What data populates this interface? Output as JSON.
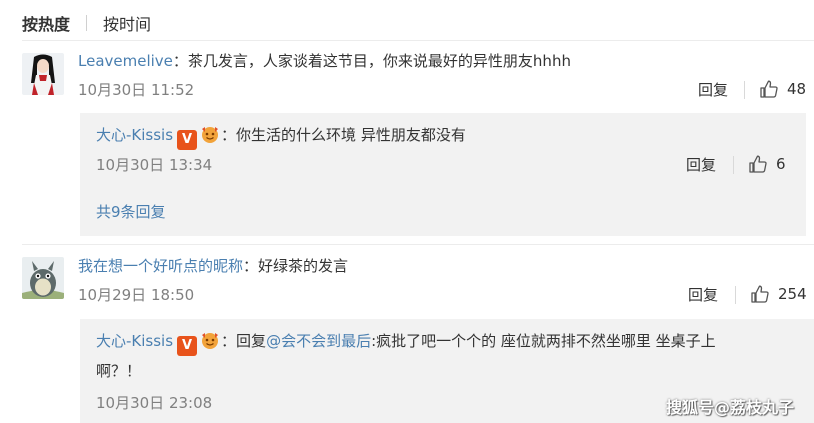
{
  "sort": {
    "hot_label": "按热度",
    "time_label": "按时间"
  },
  "comments": [
    {
      "username": "Leavemelive",
      "colon": "：",
      "text": "茶几发言，人家谈着这节目，你来说最好的异性朋友hhhh",
      "time": "10月30日 11:52",
      "reply_label": "回复",
      "likes": "48",
      "replies": [
        {
          "username": "大心-Kissis",
          "colon": "：",
          "text": "你生活的什么环境 异性朋友都没有",
          "time": "10月30日 13:34",
          "reply_label": "回复",
          "likes": "6"
        }
      ],
      "more_replies": "共9条回复"
    },
    {
      "username": "我在想一个好听点的昵称",
      "colon": "：",
      "text": "好绿茶的发言",
      "time": "10月29日 18:50",
      "reply_label": "回复",
      "likes": "254",
      "replies": [
        {
          "username": "大心-Kissis",
          "colon": "：",
          "reply_prefix": "回复",
          "mention": "@会不会到最后",
          "text_line1": ":疯批了吧一个个的 座位就两排不然坐哪里 坐桌子上",
          "text_line2": "啊？！",
          "time": "10月30日 23:08"
        }
      ]
    }
  ],
  "badges": {
    "verified": "V"
  },
  "watermark": "搜狐号@荔枝丸子",
  "colors": {
    "link": "#4a7fb0",
    "meta": "#808080",
    "subbox": "#f2f2f2",
    "vbadge": "#e8531b"
  }
}
